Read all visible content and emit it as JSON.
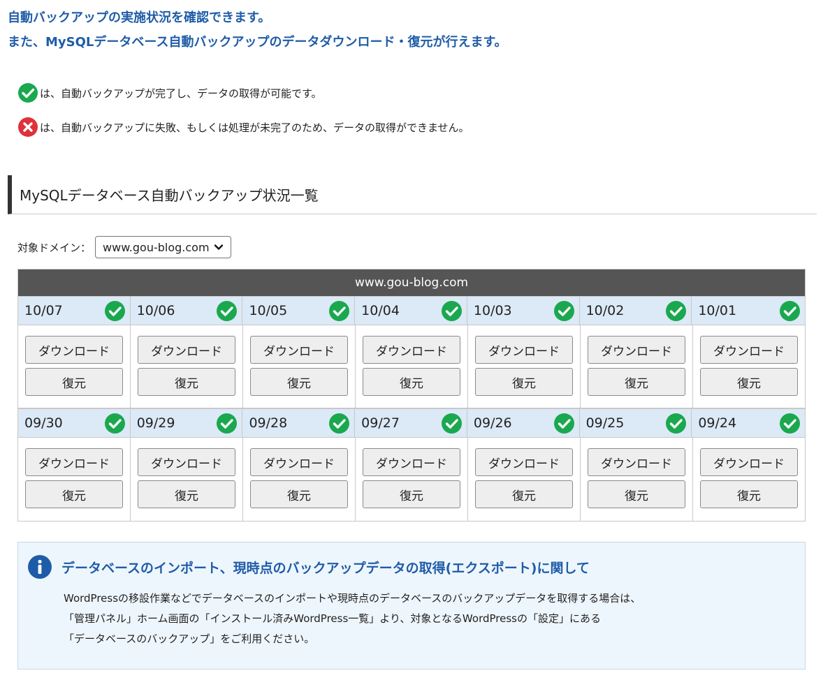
{
  "intro": {
    "line1": "自動バックアップの実施状況を確認できます。",
    "line2": "また、MySQLデータベース自動バックアップのデータダウンロード・復元が行えます。"
  },
  "legend": {
    "success_text": "は、自動バックアップが完了し、データの取得が可能です。",
    "failure_text": "は、自動バックアップに失敗、もしくは処理が未完了のため、データの取得ができません。"
  },
  "section": {
    "heading": "MySQLデータベース自動バックアップ状況一覧"
  },
  "domain_select": {
    "label": "対象ドメイン：",
    "selected": "www.gou-blog.com"
  },
  "table": {
    "title": "www.gou-blog.com",
    "download_label": "ダウンロード",
    "restore_label": "復元",
    "rows": [
      {
        "dates": [
          "10/07",
          "10/06",
          "10/05",
          "10/04",
          "10/03",
          "10/02",
          "10/01"
        ]
      },
      {
        "dates": [
          "09/30",
          "09/29",
          "09/28",
          "09/27",
          "09/26",
          "09/25",
          "09/24"
        ]
      }
    ]
  },
  "info": {
    "title": "データベースのインポート、現時点のバックアップデータの取得(エクスポート)に関して",
    "lines": [
      "WordPressの移設作業などでデータベースのインポートや現時点のデータベースのバックアップデータを取得する場合は、",
      "「管理パネル」ホーム画面の「インストール済みWordPress一覧」より、対象となるWordPressの「設定」にある",
      "「データベースのバックアップ」をご利用ください。"
    ]
  },
  "colors": {
    "accent_blue": "#1f5ca8",
    "success_green": "#1aa84f",
    "error_red": "#e0313b",
    "header_gray": "#555555",
    "date_row_bg": "#dce9f6",
    "info_bg": "#eef6fd"
  },
  "icons": {
    "success": "check-circle-icon",
    "failure": "x-circle-icon",
    "info": "info-circle-icon",
    "select": "chevron-down-icon"
  }
}
